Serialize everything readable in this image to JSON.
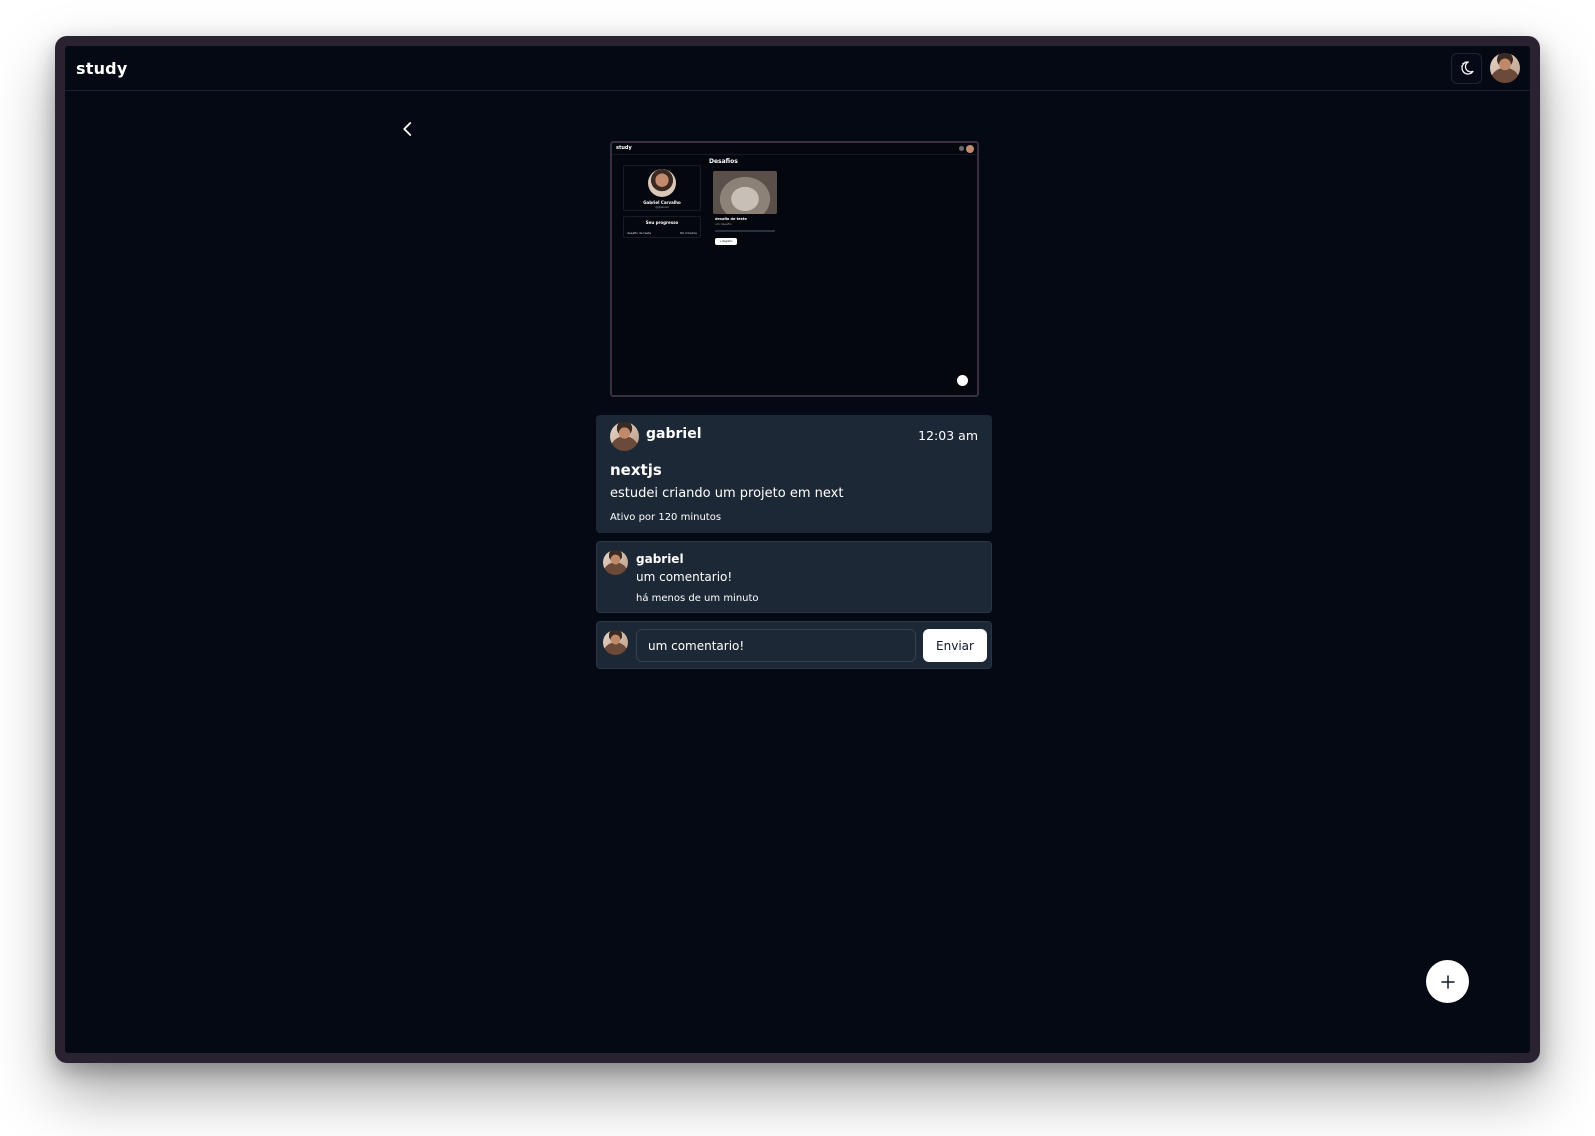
{
  "header": {
    "brand": "study",
    "theme_toggle_icon": "moon-sun-icon",
    "user_avatar_alt": "gabriel"
  },
  "preview": {
    "mini_brand": "study",
    "page_title": "Desafios",
    "profile_name": "Gabriel Carvalho",
    "profile_handle": "@gabriel",
    "progress_title": "Seu progresso",
    "progress_left": "desafio de teste",
    "progress_right": "60 minutos",
    "card_title": "desafio de teste",
    "card_subtitle": "um desafio",
    "card_button": "+ Registro"
  },
  "post": {
    "author": "gabriel",
    "time": "12:03 am",
    "title": "nextjs",
    "description": "estudei criando um projeto em next",
    "active": "Ativo por 120 minutos"
  },
  "comments": [
    {
      "author": "gabriel",
      "text": "um comentario!",
      "time": "há menos de um minuto"
    }
  ],
  "new_comment": {
    "value": "um comentario!",
    "send_label": "Enviar"
  },
  "colors": {
    "background": "#050914",
    "card": "#1d2836",
    "text": "#ffffff"
  }
}
